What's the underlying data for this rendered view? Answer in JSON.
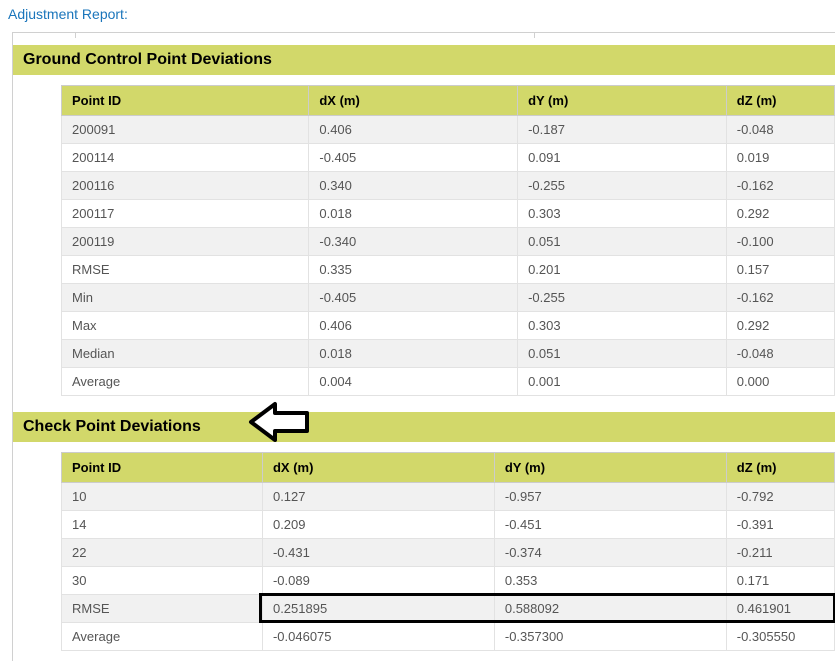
{
  "report_title": "Adjustment Report:",
  "gcp": {
    "title": "Ground Control Point Deviations",
    "headers": [
      "Point ID",
      "dX (m)",
      "dY (m)",
      "dZ (m)"
    ],
    "rows": [
      [
        "200091",
        "0.406",
        "-0.187",
        "-0.048"
      ],
      [
        "200114",
        "-0.405",
        "0.091",
        "0.019"
      ],
      [
        "200116",
        "0.340",
        "-0.255",
        "-0.162"
      ],
      [
        "200117",
        "0.018",
        "0.303",
        "0.292"
      ],
      [
        "200119",
        "-0.340",
        "0.051",
        "-0.100"
      ],
      [
        "RMSE",
        "0.335",
        "0.201",
        "0.157"
      ],
      [
        "Min",
        "-0.405",
        "-0.255",
        "-0.162"
      ],
      [
        "Max",
        "0.406",
        "0.303",
        "0.292"
      ],
      [
        "Median",
        "0.018",
        "0.051",
        "-0.048"
      ],
      [
        "Average",
        "0.004",
        "0.001",
        "0.000"
      ]
    ]
  },
  "cp": {
    "title": "Check Point Deviations",
    "headers": [
      "Point ID",
      "dX (m)",
      "dY (m)",
      "dZ (m)"
    ],
    "rows": [
      [
        "10",
        "0.127",
        "-0.957",
        "-0.792"
      ],
      [
        "14",
        "0.209",
        "-0.451",
        "-0.391"
      ],
      [
        "22",
        "-0.431",
        "-0.374",
        "-0.211"
      ],
      [
        "30",
        "-0.089",
        "0.353",
        "0.171"
      ],
      [
        "RMSE",
        "0.251895",
        "0.588092",
        "0.461901"
      ],
      [
        "Average",
        "-0.046075",
        "-0.357300",
        "-0.305550"
      ]
    ]
  }
}
